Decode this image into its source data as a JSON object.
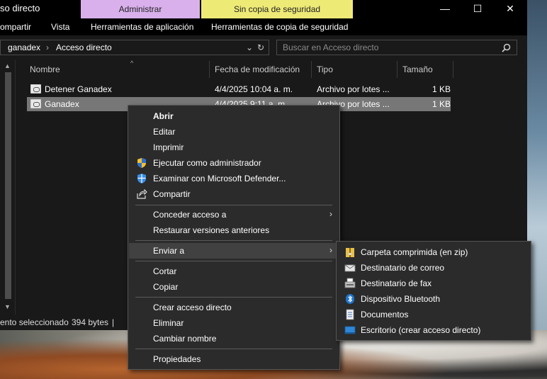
{
  "window": {
    "title": "so directo",
    "context_tabs": {
      "admin": "Administrar",
      "backup": "Sin copia de seguridad"
    },
    "controls": {
      "minimize": "—",
      "maximize": "☐",
      "close": "✕"
    }
  },
  "ribbon": {
    "tabs": [
      "ompartir",
      "Vista",
      "Herramientas de aplicación",
      "Herramientas de copia de seguridad"
    ],
    "toggle_glyph": "⌄",
    "help_glyph": "?"
  },
  "address": {
    "crumbs": [
      "ganadex",
      "Acceso directo"
    ],
    "separator": "›",
    "dropdown_glyph": "⌄",
    "refresh_glyph": "↻"
  },
  "search": {
    "placeholder": "Buscar en Acceso directo",
    "icon": "search-icon"
  },
  "columns": {
    "name": "Nombre",
    "date": "Fecha de modificación",
    "type": "Tipo",
    "size": "Tamaño",
    "sort_glyph": "^"
  },
  "files": [
    {
      "name": "Detener Ganadex",
      "date": "4/4/2025 10:04 a. m.",
      "type": "Archivo por lotes ...",
      "size": "1 KB",
      "selected": false
    },
    {
      "name": "Ganadex",
      "date": "4/4/2025 9:11 a. m.",
      "type": "Archivo por lotes ...",
      "size": "1 KB",
      "selected": true
    }
  ],
  "status": {
    "selection": "ento seleccionado",
    "size": "394 bytes",
    "divider": "|"
  },
  "context_menu": {
    "open": "Abrir",
    "edit": "Editar",
    "print": "Imprimir",
    "run_as_admin": "Ejecutar como administrador",
    "scan_defender": "Examinar con Microsoft Defender...",
    "share": "Compartir",
    "give_access": "Conceder acceso a",
    "restore_versions": "Restaurar versiones anteriores",
    "send_to": "Enviar a",
    "cut": "Cortar",
    "copy": "Copiar",
    "create_shortcut": "Crear acceso directo",
    "delete": "Eliminar",
    "rename": "Cambiar nombre",
    "properties": "Propiedades",
    "submenu_arrow": "›"
  },
  "send_to_menu": [
    {
      "label": "Carpeta comprimida (en zip)",
      "icon": "zip-folder-icon"
    },
    {
      "label": "Destinatario de correo",
      "icon": "mail-icon"
    },
    {
      "label": "Destinatario de fax",
      "icon": "fax-icon"
    },
    {
      "label": "Dispositivo Bluetooth",
      "icon": "bluetooth-icon"
    },
    {
      "label": "Documentos",
      "icon": "documents-icon"
    },
    {
      "label": "Escritorio (crear acceso directo)",
      "icon": "desktop-icon"
    }
  ],
  "colors": {
    "admin_tab": "#d9b0ec",
    "backup_tab": "#eeea76",
    "selection": "#777777",
    "menu_bg": "#2b2b2b",
    "accent_blue": "#1e73c9"
  }
}
